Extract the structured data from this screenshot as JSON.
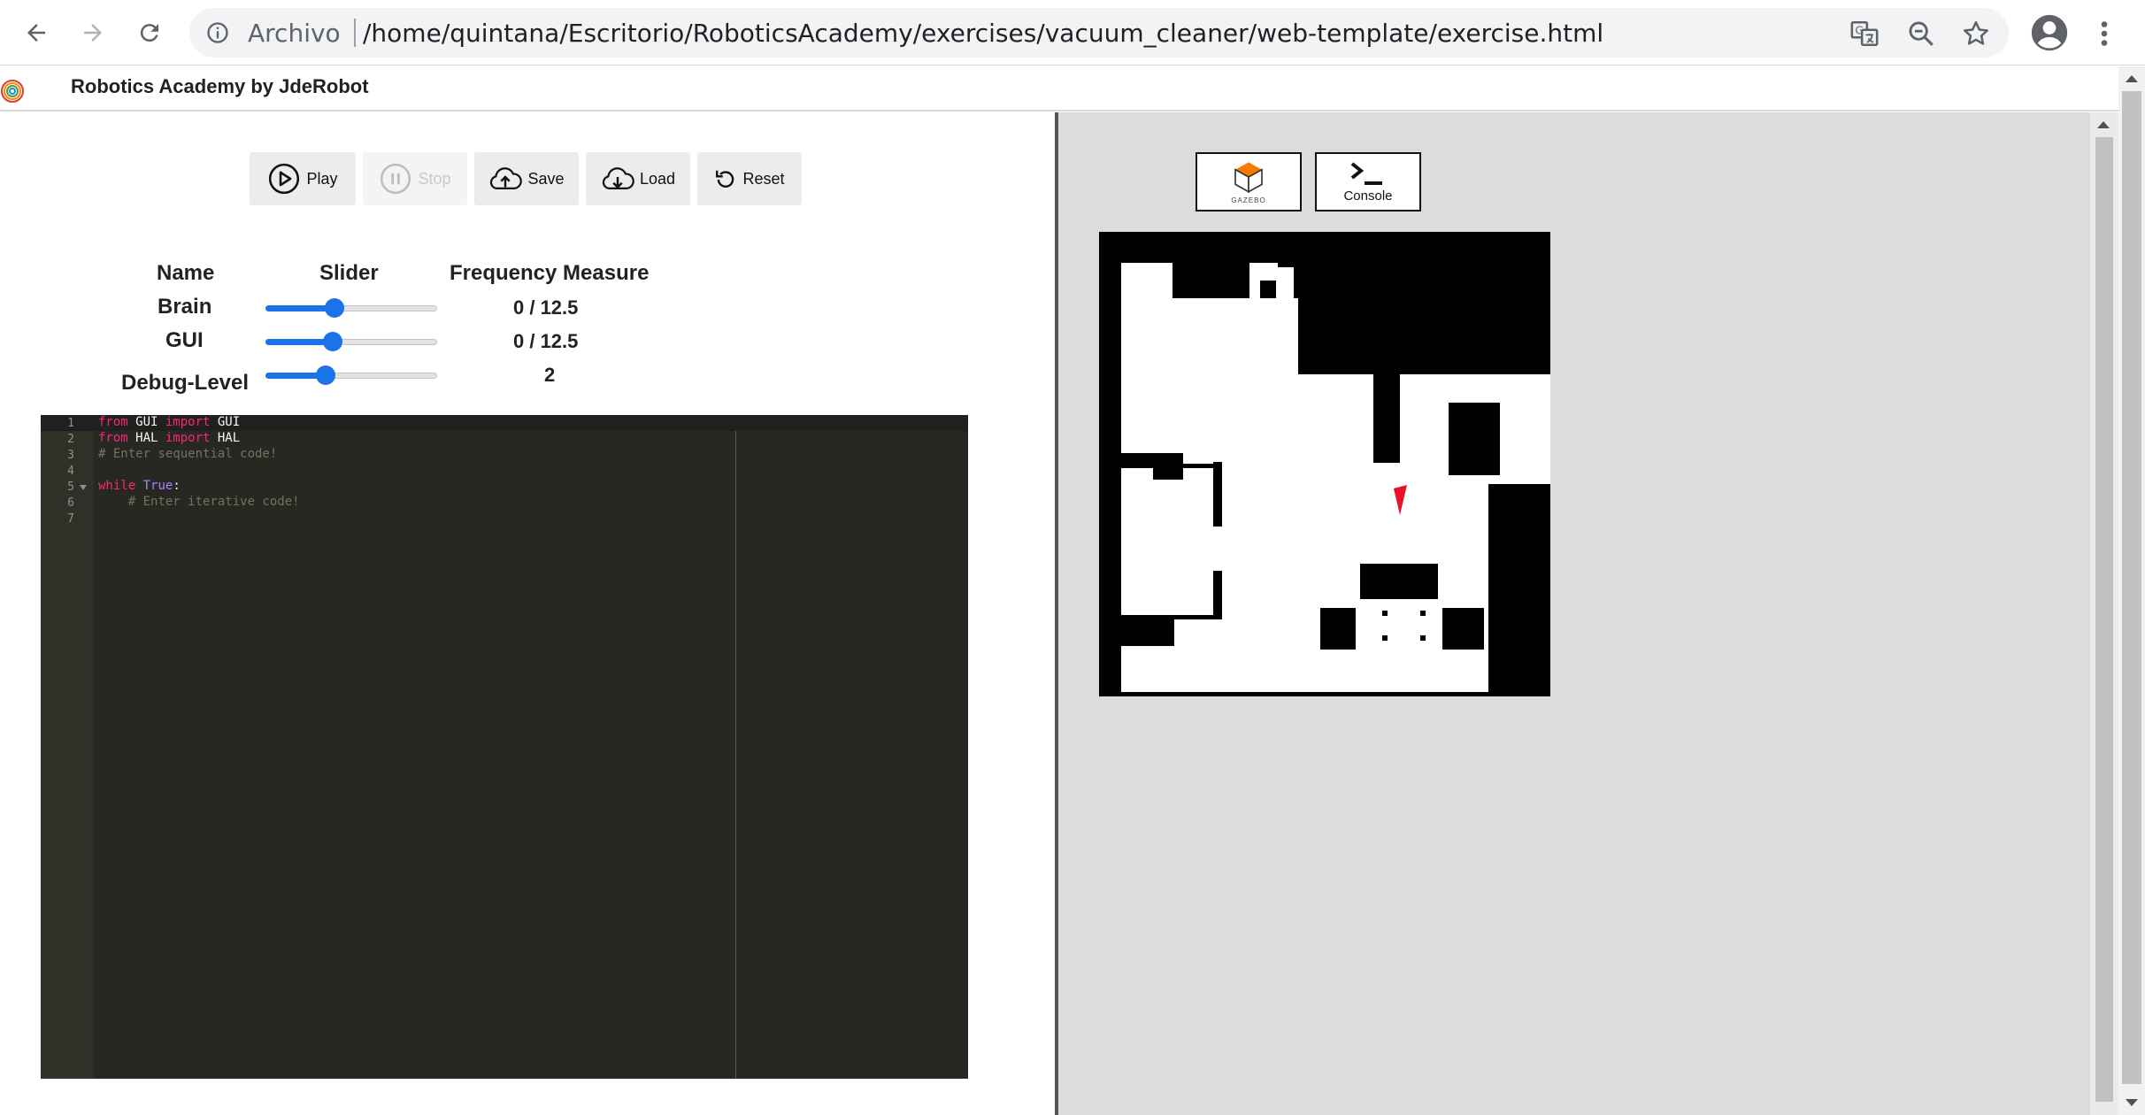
{
  "browser": {
    "scheme_label": "Archivo",
    "url": "/home/quintana/Escritorio/RoboticsAcademy/exercises/vacuum_cleaner/web-template/exercise.html"
  },
  "app": {
    "title": "Robotics Academy by JdeRobot"
  },
  "toolbar": {
    "play": "Play",
    "stop": "Stop",
    "save": "Save",
    "load": "Load",
    "reset": "Reset"
  },
  "frequency": {
    "headers": {
      "name": "Name",
      "slider": "Slider",
      "measure": "Frequency Measure"
    },
    "rows": [
      {
        "name": "Brain",
        "value": "0 / 12.5",
        "slider_level": 0.4
      },
      {
        "name": "GUI",
        "value": "0 / 12.5",
        "slider_level": 0.39
      },
      {
        "name": "Debug-Level",
        "value": "2",
        "slider_level": 0.35
      }
    ]
  },
  "editor": {
    "line_numbers": [
      "1",
      "2",
      "3",
      "4",
      "5",
      "6",
      "7"
    ]
  },
  "tools": {
    "gazebo_label": "GAZEBO",
    "console_label": "Console"
  },
  "colors": {
    "accent": "#1a73e8",
    "robot": "#e8102a",
    "editor_bg": "#272822"
  }
}
